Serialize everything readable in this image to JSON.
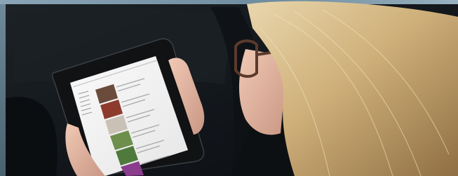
{
  "image": {
    "subject": "woman-reading-tablet"
  },
  "colors": {
    "hair": "#d8c08e",
    "seat": "#15191d",
    "frame": "#7f9aab",
    "skin": "#e2b9a2",
    "tablet_bezel": "#101214",
    "screen": "#f2f2f2"
  }
}
